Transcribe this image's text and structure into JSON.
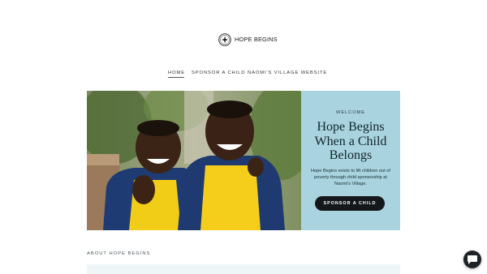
{
  "brand": {
    "name": "HOPE BEGINS",
    "logo_icon": "emblem-icon"
  },
  "nav": {
    "items": [
      {
        "label": "HOME",
        "active": true
      },
      {
        "label": "SPONSOR A CHILD",
        "active": false
      },
      {
        "label": "NAOMI'S VILLAGE WEBSITE",
        "active": false
      }
    ]
  },
  "hero": {
    "eyebrow": "WELCOME",
    "headline": "Hope Begins When a Child Belongs",
    "blurb": "Hope Begins exists to lift children out of poverty through child sponsorship at Naomi's Village.",
    "cta_label": "SPONSOR A CHILD",
    "panel_color": "#a8d3df",
    "button_color": "#14181b"
  },
  "about": {
    "label": "ABOUT HOPE BEGINS"
  },
  "chat": {
    "icon": "chat-bubble-icon"
  }
}
